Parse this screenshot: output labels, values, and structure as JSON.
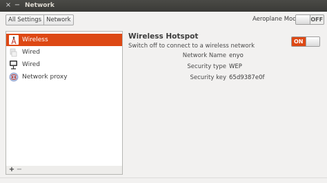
{
  "window": {
    "title": "Network",
    "close_glyph": "×",
    "minimize_glyph": "−"
  },
  "toolbar": {
    "breadcrumb": [
      "All Settings",
      "Network"
    ],
    "aeroplane_label": "Aeroplane Mode",
    "aeroplane_state": "OFF"
  },
  "sidebar": {
    "items": [
      {
        "label": "Wireless",
        "icon": "wireless-tower-icon",
        "selected": true
      },
      {
        "label": "Wired",
        "icon": "wired-disconnected-icon"
      },
      {
        "label": "Wired",
        "icon": "wired-ethernet-icon"
      },
      {
        "label": "Network proxy",
        "icon": "network-proxy-icon"
      }
    ],
    "add_label": "+",
    "remove_label": "−"
  },
  "hotspot": {
    "title": "Wireless Hotspot",
    "subtitle": "Switch off to connect to a wireless network",
    "switch_state": "ON",
    "fields": [
      {
        "key": "Network Name",
        "value": "enyo"
      },
      {
        "key": "Security type",
        "value": "WEP"
      },
      {
        "key": "Security key",
        "value": "65d9387e0f"
      }
    ]
  },
  "colors": {
    "accent": "#dd4814",
    "titlebar": "#3c3b37",
    "background": "#f2f1f0"
  }
}
